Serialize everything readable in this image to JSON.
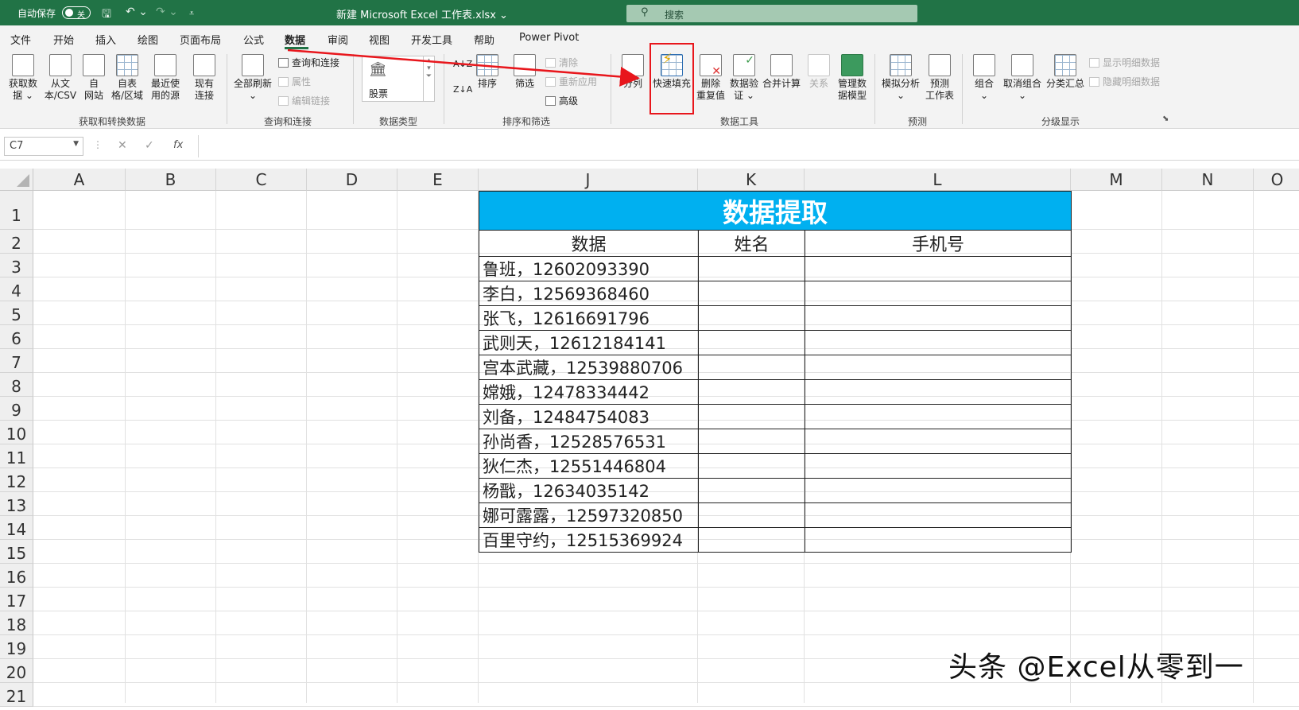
{
  "titlebar": {
    "autosave_label": "自动保存",
    "autosave_state": "关",
    "doc_title": "新建 Microsoft Excel 工作表.xlsx ⌄",
    "search_placeholder": "搜索"
  },
  "menu": {
    "tabs": [
      "文件",
      "开始",
      "插入",
      "绘图",
      "页面布局",
      "公式",
      "数据",
      "审阅",
      "视图",
      "开发工具",
      "帮助",
      "Power Pivot"
    ],
    "active": "数据"
  },
  "ribbon": {
    "get_data": {
      "get_data": "获取数\n据 ⌄",
      "from_text": "从文\n本/CSV",
      "from_web": "自\n网站",
      "from_table": "自表\n格/区域",
      "recent": "最近使\n用的源",
      "existing": "现有\n连接",
      "group": "获取和转换数据"
    },
    "queries": {
      "refresh_all": "全部刷新\n⌄",
      "queries_connections": "查询和连接",
      "properties": "属性",
      "edit_links": "编辑链接",
      "group": "查询和连接"
    },
    "data_types": {
      "stock": "股票",
      "group": "数据类型"
    },
    "sort_filter": {
      "sort": "排序",
      "filter": "筛选",
      "clear": "清除",
      "reapply": "重新应用",
      "advanced": "高级",
      "group": "排序和筛选"
    },
    "data_tools": {
      "text_to_columns": "分列",
      "flash_fill": "快速填充",
      "remove_duplicates": "删除\n重复值",
      "data_validation": "数据验\n证 ⌄",
      "consolidate": "合并计算",
      "relationships": "关系",
      "data_model": "管理数\n据模型",
      "group": "数据工具"
    },
    "forecast": {
      "what_if": "模拟分析\n⌄",
      "forecast_sheet": "预测\n工作表",
      "group": "预测"
    },
    "outline": {
      "group_btn": "组合\n⌄",
      "ungroup": "取消组合\n⌄",
      "subtotal": "分类汇总",
      "show_detail": "显示明细数据",
      "hide_detail": "隐藏明细数据",
      "group": "分级显示"
    }
  },
  "formula_bar": {
    "name_box": "C7",
    "fx": "fx",
    "formula": ""
  },
  "columns": [
    "A",
    "B",
    "C",
    "D",
    "E",
    "J",
    "K",
    "L",
    "M",
    "N",
    "O"
  ],
  "rows": [
    "1",
    "2",
    "3",
    "4",
    "5",
    "6",
    "7",
    "8",
    "9",
    "10",
    "11",
    "12",
    "13",
    "14",
    "15",
    "16",
    "17",
    "18",
    "19",
    "20",
    "21"
  ],
  "table": {
    "title": "数据提取",
    "headers": [
      "数据",
      "姓名",
      "手机号"
    ],
    "rows": [
      "鲁班，12602093390",
      "李白，12569368460",
      "张飞，12616691796",
      "武则天，12612184141",
      "宫本武藏，12539880706",
      "嫦娥，12478334442",
      "刘备，12484754083",
      "孙尚香，12528576531",
      "狄仁杰，12551446804",
      "杨戬，12634035142",
      "娜可露露，12597320850",
      "百里守约，12515369924"
    ]
  },
  "watermark": "头条 @Excel从零到一",
  "colors": {
    "excel_green": "#217346",
    "title_fill": "#00b0f0",
    "highlight": "#e8161c"
  }
}
